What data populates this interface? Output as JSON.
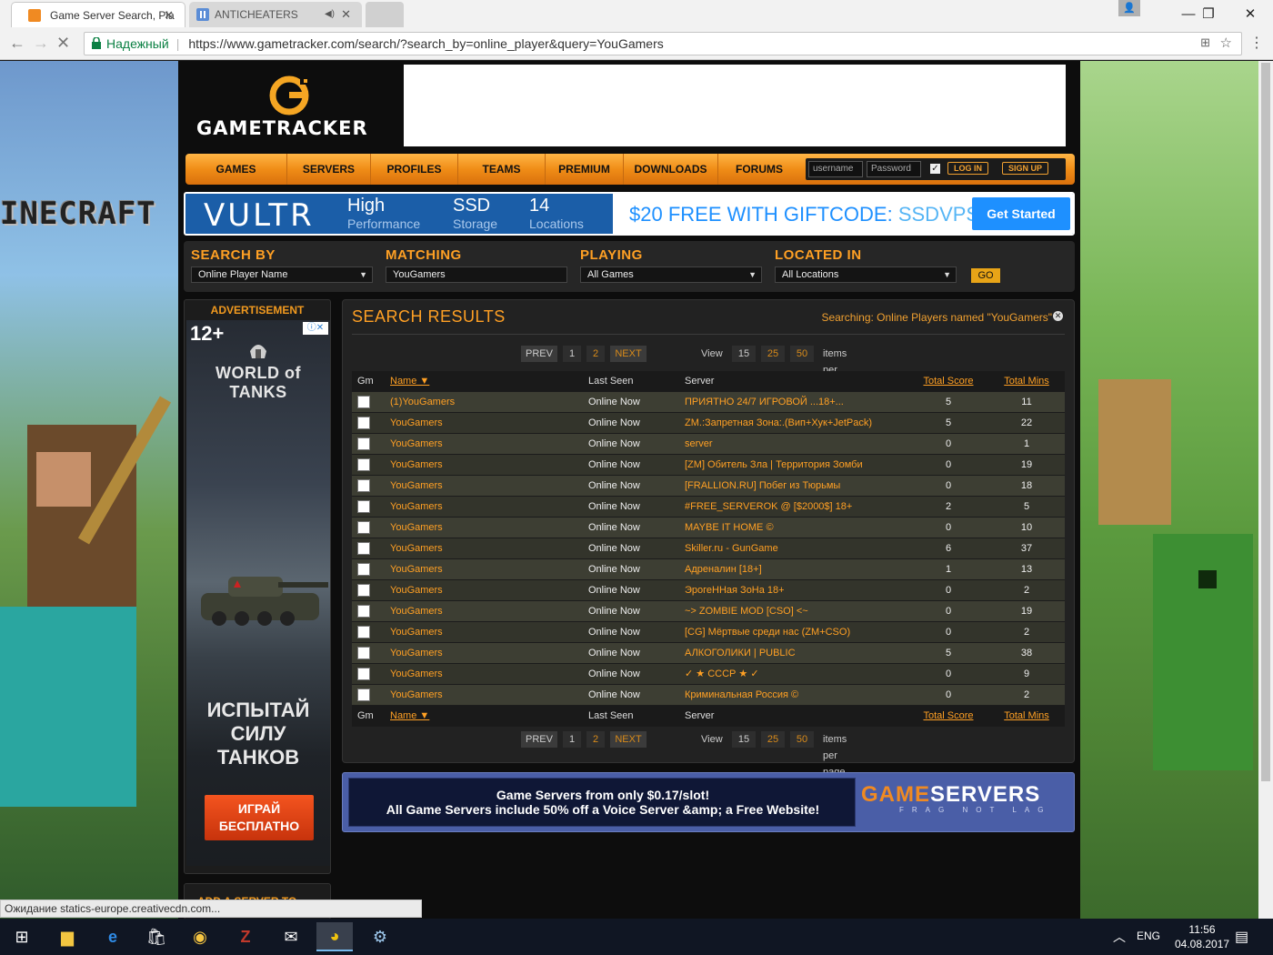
{
  "browser": {
    "tabs": [
      {
        "title": "Game Server Search, Pla"
      },
      {
        "title": "ANTICHEATERS"
      }
    ],
    "secure_label": "Надежный",
    "url": "https://www.gametracker.com/search/?search_by=online_player&query=YouGamers",
    "status": "Ожидание statics-europe.creativecdn.com..."
  },
  "site": {
    "logo": "GAMETRACKER",
    "background_logo": "INECRAFT",
    "nav": [
      "GAMES",
      "SERVERS",
      "PROFILES",
      "TEAMS",
      "PREMIUM",
      "DOWNLOADS",
      "FORUMS"
    ],
    "login": {
      "username_placeholder": "username",
      "password_placeholder": "Password",
      "login_label": "LOG IN",
      "signup_label": "SIGN UP"
    },
    "vultr": {
      "logo": "VULTR",
      "feat1_title": "High",
      "feat1_sub": "Performance",
      "feat2_title": "SSD",
      "feat2_sub": "Storage",
      "feat3_title": "14",
      "feat3_sub": "Locations",
      "offer": "$20 FREE WITH GIFTCODE:",
      "code": "SSDVPS",
      "cta": "Get Started"
    },
    "search": {
      "search_by_label": "SEARCH BY",
      "search_by_value": "Online Player Name",
      "matching_label": "MATCHING",
      "matching_value": "YouGamers",
      "playing_label": "PLAYING",
      "playing_value": "All Games",
      "located_label": "LOCATED IN",
      "located_value": "All Locations",
      "go_label": "GO"
    },
    "advertisement": {
      "title": "ADVERTISEMENT",
      "age": "12+",
      "brand": "WORLD of TANKS",
      "slogan_line1": "ИСПЫТАЙ",
      "slogan_line2": "СИЛУ",
      "slogan_line3": "ТАНКОВ",
      "cta_line1": "ИГРАЙ",
      "cta_line2": "БЕСПЛАТНО",
      "second_title": "ADD A SERVER TO"
    },
    "results": {
      "title": "SEARCH RESULTS",
      "searching": "Searching: Online Players named \"YouGamers\"",
      "pager": {
        "prev": "PREV",
        "page1": "1",
        "page2": "2",
        "next": "NEXT",
        "view": "View",
        "opt15": "15",
        "opt25": "25",
        "opt50": "50",
        "per_page": "items per page"
      },
      "columns": {
        "gm": "Gm",
        "name": "Name ▼",
        "last_seen": "Last Seen",
        "server": "Server",
        "total_score": "Total Score",
        "total_mins": "Total Mins"
      },
      "rows": [
        {
          "name": "(1)YouGamers",
          "last_seen": "Online Now",
          "server": "ПРИЯТНО 24/7 ИГРОВОЙ ...18+...",
          "score": "5",
          "mins": "11"
        },
        {
          "name": "YouGamers",
          "last_seen": "Online Now",
          "server": "ZM.:Запретная Зона:.(Вип+Хук+JetPack)",
          "score": "5",
          "mins": "22"
        },
        {
          "name": "YouGamers",
          "last_seen": "Online Now",
          "server": "server",
          "score": "0",
          "mins": "1"
        },
        {
          "name": "YouGamers",
          "last_seen": "Online Now",
          "server": "[ZM] Обитель Зла | Территория Зомби",
          "score": "0",
          "mins": "19"
        },
        {
          "name": "YouGamers",
          "last_seen": "Online Now",
          "server": "[FRALLION.RU] Побег из Тюрьмы",
          "score": "0",
          "mins": "18"
        },
        {
          "name": "YouGamers",
          "last_seen": "Online Now",
          "server": "#FREE_SERVEROK @ [$2000$] 18+",
          "score": "2",
          "mins": "5"
        },
        {
          "name": "YouGamers",
          "last_seen": "Online Now",
          "server": "MAYBE IT HOME ©",
          "score": "0",
          "mins": "10"
        },
        {
          "name": "YouGamers",
          "last_seen": "Online Now",
          "server": "Skiller.ru - GunGame",
          "score": "6",
          "mins": "37"
        },
        {
          "name": "YouGamers",
          "last_seen": "Online Now",
          "server": "Адреналин [18+]",
          "score": "1",
          "mins": "13"
        },
        {
          "name": "YouGamers",
          "last_seen": "Online Now",
          "server": "ЭрогеННая ЗоНа 18+",
          "score": "0",
          "mins": "2"
        },
        {
          "name": "YouGamers",
          "last_seen": "Online Now",
          "server": "~> ZOMBIE MOD [CSO] <~",
          "score": "0",
          "mins": "19"
        },
        {
          "name": "YouGamers",
          "last_seen": "Online Now",
          "server": "[CG] Мёртвые среди нас (ZM+CSO)",
          "score": "0",
          "mins": "2"
        },
        {
          "name": "YouGamers",
          "last_seen": "Online Now",
          "server": "АЛКОГОЛИКИ | PUBLIC",
          "score": "5",
          "mins": "38"
        },
        {
          "name": "YouGamers",
          "last_seen": "Online Now",
          "server": "✓ ★ СССР ★ ✓",
          "score": "0",
          "mins": "9"
        },
        {
          "name": "YouGamers",
          "last_seen": "Online Now",
          "server": "Криминальная Россия ©",
          "score": "0",
          "mins": "2"
        }
      ]
    },
    "gameservers": {
      "line1": "Game Servers from only $0.17/slot!",
      "line2": "All Game Servers include 50% off a Voice Server &amp; a Free Website!",
      "logo_a": "GAME",
      "logo_b": "SERVERS",
      "tagline": "FRAG NOT LAG"
    }
  },
  "taskbar": {
    "lang": "ENG",
    "time": "11:56",
    "date": "04.08.2017"
  }
}
